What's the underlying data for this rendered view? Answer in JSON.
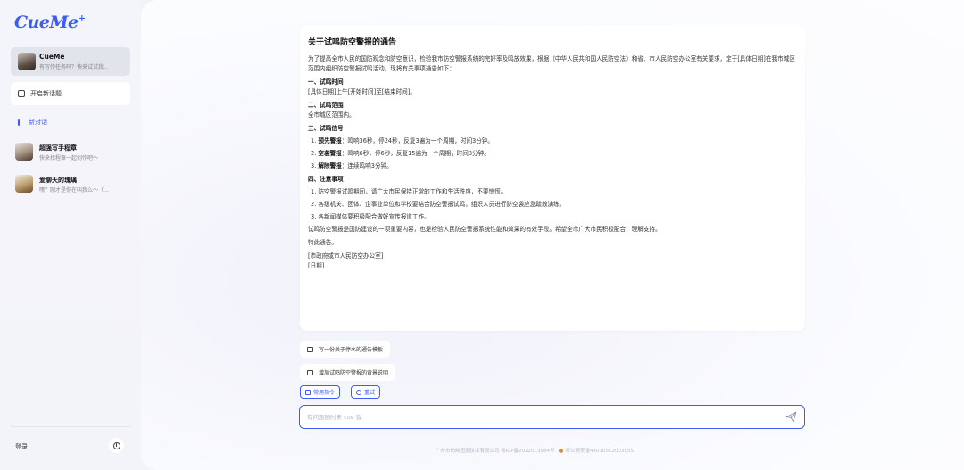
{
  "brand": {
    "logo": "CueMe",
    "logo_plus": "+"
  },
  "sidebar": {
    "agent": {
      "title": "CueMe",
      "subtitle": "有写作任务吗？快来试试我..."
    },
    "new_topic": "开启新话题",
    "new_chat": "新对话",
    "bots": [
      {
        "title": "超强写手程章",
        "subtitle": "快来找程章一起创作吧～"
      },
      {
        "title": "爱聊天的瑰璃",
        "subtitle": "嘿？刚才是你在叫我么～（..."
      }
    ],
    "login": "登录"
  },
  "message": {
    "title": "关于试鸣防空警报的通告",
    "intro": "为了提高全市人民的国防观念和防空意识，检验我市防空警报系统的完好率及鸣放效果，根据《中华人民共和国人民防空法》和省、市人民防空办公室有关要求，定于[具体日期]在我市城区范围内组织防空警报试鸣活动。现将有关事项通告如下：",
    "s1_h": "一、试鸣时间",
    "s1_p": "[具体日期]上午[开始时间]至[结束时间]。",
    "s2_h": "二、试鸣范围",
    "s2_p": "全市城区范围内。",
    "s3_h": "三、试鸣信号",
    "s3_items": [
      {
        "n": "1.",
        "b": "预先警报",
        "t": "：鸣响36秒，停24秒，反复3遍为一个周期，时间3分钟。"
      },
      {
        "n": "2.",
        "b": "空袭警报",
        "t": "：鸣响6秒，停6秒，反复15遍为一个周期，时间3分钟。"
      },
      {
        "n": "3.",
        "b": "解除警报",
        "t": "：连续鸣响3分钟。"
      }
    ],
    "s4_h": "四、注意事项",
    "s4_items": [
      "1. 防空警报试鸣期间，请广大市民保持正常的工作和生活秩序，不要惊慌。",
      "2. 各级机关、团体、企事业单位和学校要结合防空警报试鸣，组织人员进行防空袭应急疏散演练。",
      "3. 各新闻媒体要积极配合做好宣传报道工作。"
    ],
    "closing": "试鸣防空警报是国防建设的一项重要内容，也是检验人民防空警报系统性能和效果的有效手段。希望全市广大市民积极配合，理解支持。",
    "notice": "特此通告。",
    "signer": "[市政府或市人民防空办公室]",
    "date": "[日期]"
  },
  "suggestions": [
    "写一份关于停水的通告模板",
    "增加试鸣防空警报的背景说明"
  ],
  "actions": {
    "common": "常用指令",
    "retry": "重试"
  },
  "input": {
    "placeholder": "有问题随时来 cue 我",
    "value": ""
  },
  "footer": {
    "icp": "广州市动映图景技术有限公司 粤ICP备2022013984号",
    "police": "粤公网安备44010502003055"
  },
  "colors": {
    "accent": "#3d5cf5"
  }
}
